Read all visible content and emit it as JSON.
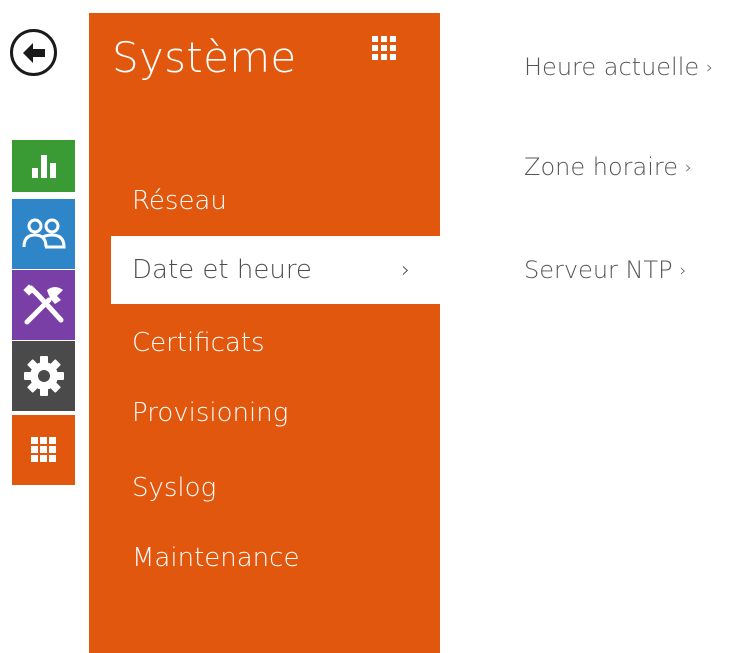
{
  "panel": {
    "title": "Système",
    "menu": [
      {
        "label": "Réseau"
      },
      {
        "label": "Date et heure",
        "chevron": "›"
      },
      {
        "label": "Certificats"
      },
      {
        "label": "Provisioning"
      },
      {
        "label": "Syslog"
      },
      {
        "label": "Maintenance"
      }
    ]
  },
  "content": {
    "links": [
      {
        "label": "Heure actuelle",
        "chevron": "›"
      },
      {
        "label": "Zone horaire",
        "chevron": "›"
      },
      {
        "label": "Serveur NTP",
        "chevron": "›"
      }
    ]
  },
  "rail": {
    "items": [
      {
        "icon": "bar-chart-icon",
        "color": "#3a9b35"
      },
      {
        "icon": "users-icon",
        "color": "#2e86c8"
      },
      {
        "icon": "tools-icon",
        "color": "#7a3fa6"
      },
      {
        "icon": "gear-icon",
        "color": "#4a4a4a"
      },
      {
        "icon": "grid-icon",
        "color": "#e1570d"
      }
    ]
  },
  "colors": {
    "accent": "#e1570d",
    "text": "#555555"
  }
}
